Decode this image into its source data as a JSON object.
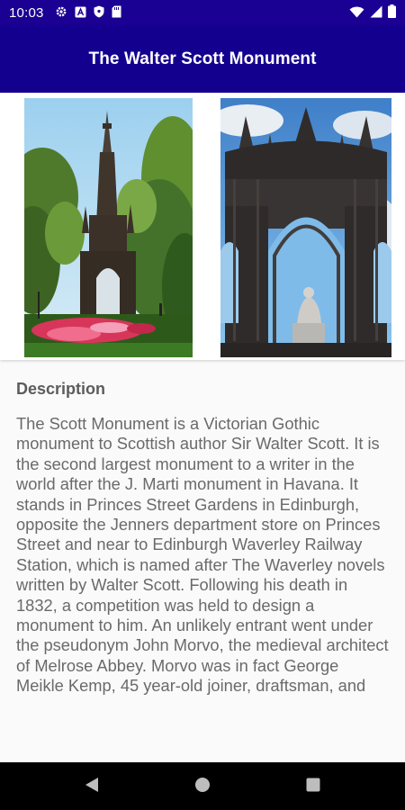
{
  "status_bar": {
    "time": "10:03",
    "left_icons": [
      "gear-icon",
      "font-icon",
      "shield-icon",
      "sd-card-icon"
    ],
    "right_icons": [
      "wifi-icon",
      "signal-icon",
      "battery-icon"
    ]
  },
  "app_bar": {
    "title": "The Walter Scott Monument",
    "color": "#14008f"
  },
  "images": [
    {
      "name": "monument-street-view-photo"
    },
    {
      "name": "monument-arch-closeup-photo"
    }
  ],
  "description": {
    "heading": "Description",
    "body": "The Scott Monument is a Victorian Gothic monument to Scottish author Sir Walter Scott. It is the second largest monument to a writer in the world after the J. Marti monument in Havana. It stands in Princes Street Gardens in Edinburgh, opposite the Jenners department store on Princes Street and near to Edinburgh Waverley Railway Station, which is named after The Waverley novels written by Walter Scott. Following his death in 1832, a competition was held to design a monument to him. An unlikely entrant went under the pseudonym John Morvo, the medieval architect of Melrose Abbey. Morvo was in fact George Meikle Kemp, 45 year-old joiner, draftsman, and"
  },
  "nav_bar": {
    "buttons": [
      "back-icon",
      "home-icon",
      "recents-icon"
    ]
  }
}
